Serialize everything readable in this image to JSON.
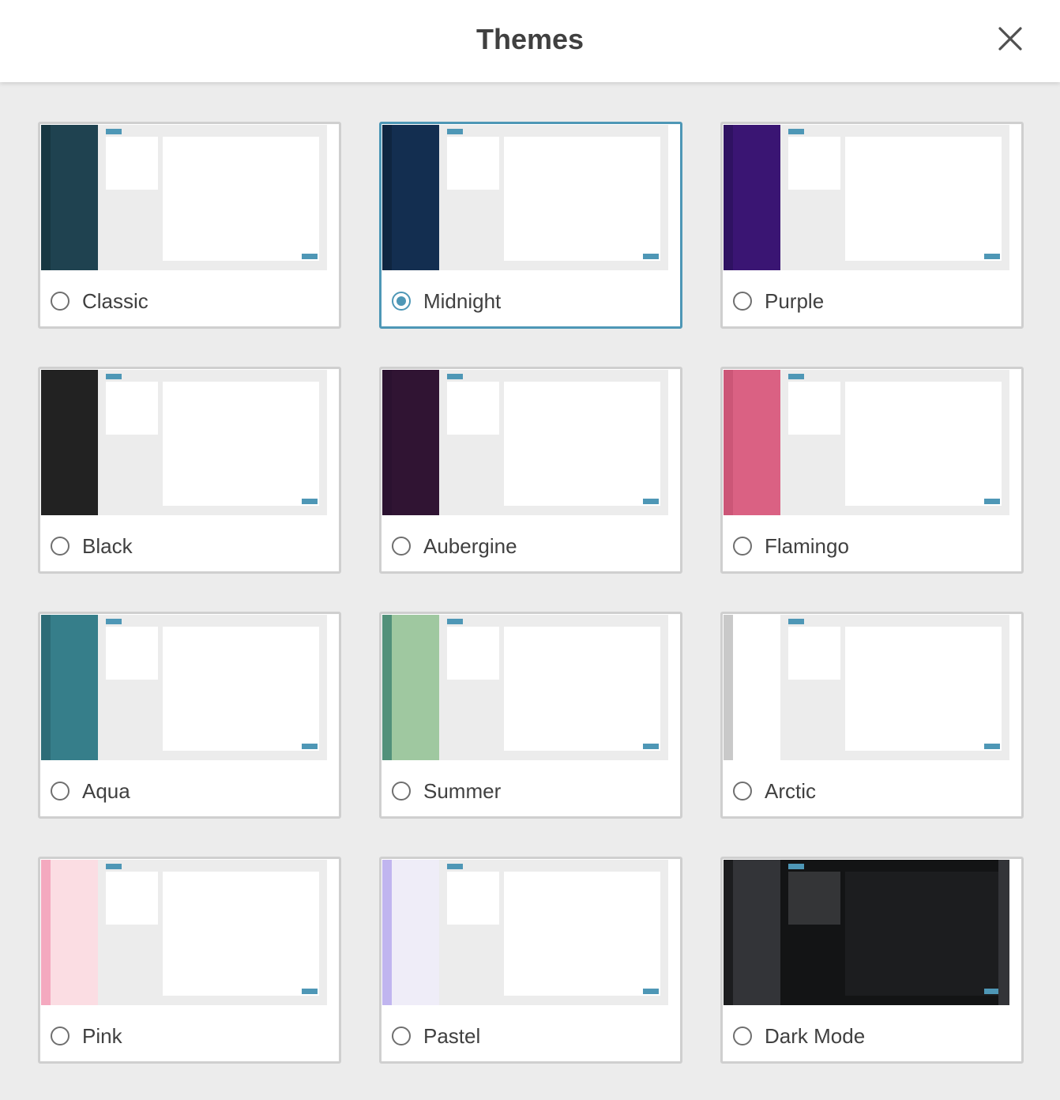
{
  "header": {
    "title": "Themes",
    "close_icon": "close-icon"
  },
  "accent_color": "#4e97b6",
  "selected_theme": "Midnight",
  "themes": [
    {
      "name": "Classic",
      "selected": false,
      "sidebar_outer": "#173742",
      "sidebar": "#1f4250",
      "bg": "#ececec",
      "pane": "#ffffff",
      "right_strip": ""
    },
    {
      "name": "Midnight",
      "selected": true,
      "sidebar_outer": "#0f2540",
      "sidebar": "#132e50",
      "bg": "#ececec",
      "pane": "#ffffff",
      "right_strip": ""
    },
    {
      "name": "Purple",
      "selected": false,
      "sidebar_outer": "#2f1262",
      "sidebar": "#3a1573",
      "bg": "#ececec",
      "pane": "#ffffff",
      "right_strip": ""
    },
    {
      "name": "Black",
      "selected": false,
      "sidebar_outer": "#222222",
      "sidebar": "#222222",
      "bg": "#ececec",
      "pane": "#ffffff",
      "right_strip": ""
    },
    {
      "name": "Aubergine",
      "selected": false,
      "sidebar_outer": "#2b1230",
      "sidebar": "#301433",
      "bg": "#ececec",
      "pane": "#ffffff",
      "right_strip": ""
    },
    {
      "name": "Flamingo",
      "selected": false,
      "sidebar_outer": "#cc5677",
      "sidebar": "#da6183",
      "bg": "#ececec",
      "pane": "#ffffff",
      "right_strip": ""
    },
    {
      "name": "Aqua",
      "selected": false,
      "sidebar_outer": "#2d6c77",
      "sidebar": "#367e8a",
      "bg": "#ececec",
      "pane": "#ffffff",
      "right_strip": ""
    },
    {
      "name": "Summer",
      "selected": false,
      "sidebar_outer": "#52917a",
      "sidebar": "#9fc8a0",
      "bg": "#ececec",
      "pane": "#ffffff",
      "right_strip": ""
    },
    {
      "name": "Arctic",
      "selected": false,
      "sidebar_outer": "#c9c9c9",
      "sidebar": "#ffffff",
      "bg": "#ececec",
      "pane": "#ffffff",
      "right_strip": ""
    },
    {
      "name": "Pink",
      "selected": false,
      "sidebar_outer": "#f4a9bf",
      "sidebar": "#fbdde3",
      "bg": "#ececec",
      "pane": "#ffffff",
      "right_strip": ""
    },
    {
      "name": "Pastel",
      "selected": false,
      "sidebar_outer": "#c0b5ef",
      "sidebar": "#efedf8",
      "bg": "#ececec",
      "pane": "#ffffff",
      "right_strip": ""
    },
    {
      "name": "Dark Mode",
      "selected": false,
      "sidebar_outer": "#1c1d1f",
      "sidebar": "#333438",
      "bg": "#131415",
      "pane": "#1c1d1f",
      "small_pane": "#343537",
      "right_strip": "#333438"
    }
  ]
}
